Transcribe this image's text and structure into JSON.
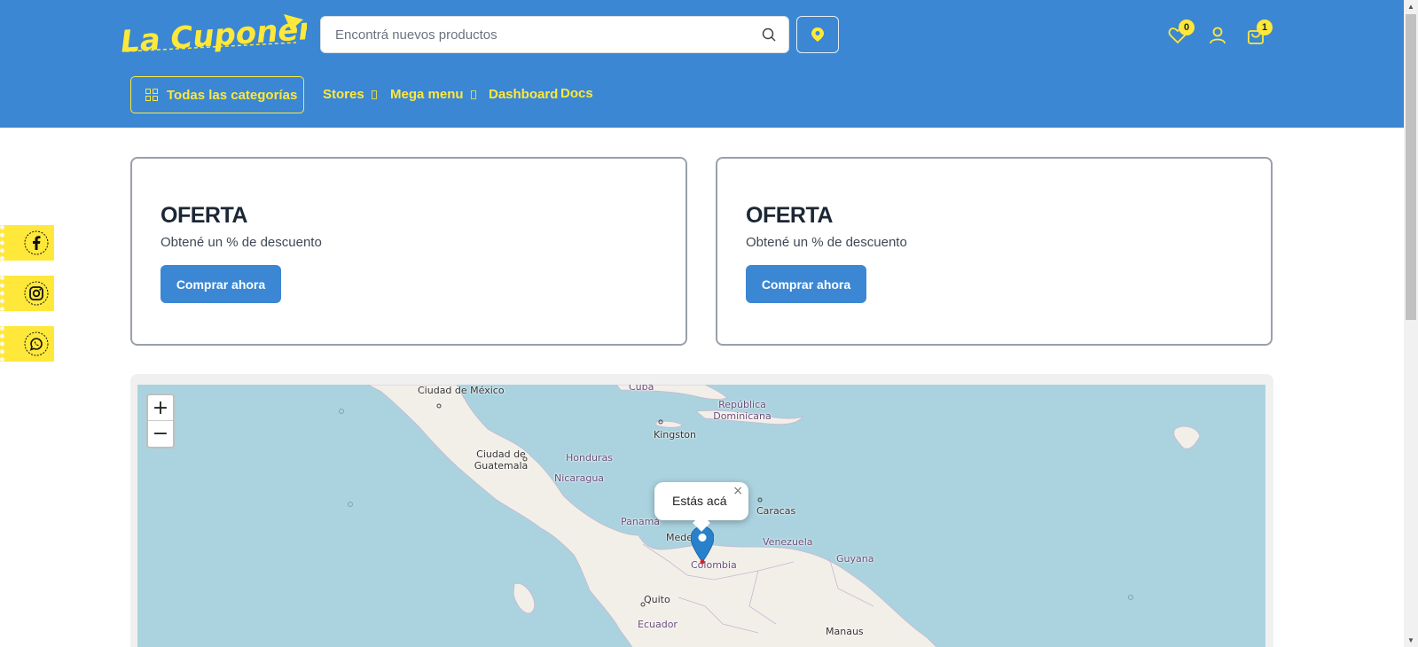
{
  "header": {
    "logo_text": "La Cuponera",
    "search": {
      "placeholder": "Encontrá nuevos productos"
    },
    "wishlist_count": "0",
    "cart_count": "1"
  },
  "nav": {
    "categories_label": "Todas las categorías",
    "links": [
      {
        "label": "Stores",
        "has_dropdown": true
      },
      {
        "label": "Mega menu",
        "has_dropdown": true
      },
      {
        "label": "Dashboard",
        "has_dropdown": false
      },
      {
        "label": "Docs",
        "has_dropdown": false
      }
    ]
  },
  "offers": [
    {
      "title": "OFERTA",
      "subtitle": "Obtené un % de descuento",
      "button": "Comprar ahora"
    },
    {
      "title": "OFERTA",
      "subtitle": "Obtené un % de descuento",
      "button": "Comprar ahora"
    }
  ],
  "social": [
    "facebook",
    "instagram",
    "whatsapp"
  ],
  "map": {
    "zoom_in": "+",
    "zoom_out": "−",
    "popup_text": "Estás acá",
    "popup_close": "×",
    "labels": [
      "Ciudad de México",
      "Cuba",
      "República Dominicana",
      "Kingston",
      "Ciudad de Guatemala",
      "Honduras",
      "Nicaragua",
      "Panamá",
      "Caracas",
      "Venezuela",
      "Guyana",
      "Medellín",
      "Colombia",
      "Quito",
      "Ecuador",
      "Manaus"
    ]
  },
  "colors": {
    "brand_blue": "#3b87d3",
    "brand_yellow": "#ffe83a",
    "sea": "#aad3df",
    "land": "#f2efe9"
  }
}
